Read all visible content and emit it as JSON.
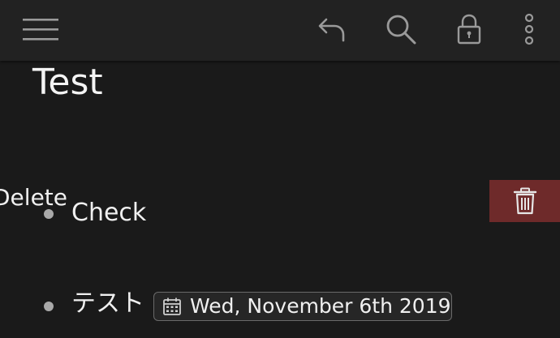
{
  "toolbar": {
    "menu_icon": "hamburger-menu-icon",
    "undo_icon": "undo-arrow-icon",
    "search_icon": "search-icon",
    "lock_icon": "lock-icon",
    "more_icon": "more-vertical-icon"
  },
  "note": {
    "title": "Test",
    "items": [
      {
        "text": "Check"
      },
      {
        "text": "テスト",
        "date_chip": {
          "icon": "calendar-icon",
          "label": "Wed, November 6th 2019"
        }
      }
    ]
  },
  "swipe_action": {
    "label": "Delete",
    "icon": "trash-icon",
    "color": "#6e2a2a"
  },
  "colors": {
    "background": "#1a1a1a",
    "toolbar": "#222222",
    "icon": "#9a9a9a",
    "text": "#f0f0f0"
  }
}
